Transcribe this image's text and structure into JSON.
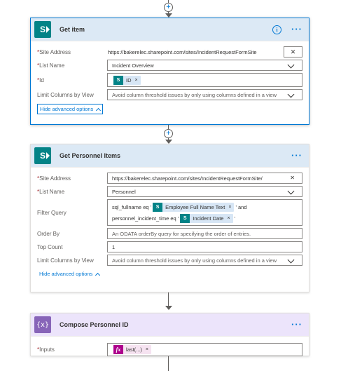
{
  "get_item": {
    "title": "Get item",
    "site_address_label": "Site Address",
    "site_address_value": "https://bakerelec.sharepoint.com/sites/IncidentRequestFormSite",
    "list_name_label": "List Name",
    "list_name_value": "Incident Overview",
    "id_label": "Id",
    "id_token": "ID",
    "limit_label": "Limit Columns by View",
    "limit_placeholder": "Avoid column threshold issues by only using columns defined in a view",
    "advanced_link": "Hide advanced options"
  },
  "get_personnel": {
    "title": "Get Personnel Items",
    "site_address_label": "Site Address",
    "site_address_value": "https://bakerelec.sharepoint.com/sites/IncidentRequestFormSite/",
    "list_name_label": "List Name",
    "list_name_value": "Personnel",
    "filter_label": "Filter Query",
    "filter_line1_prefix": "sql_fullname eq '",
    "filter_token1": "Employee Full Name Text",
    "filter_line1_suffix": "' and",
    "filter_line2_prefix": "personnel_incident_time eq '",
    "filter_token2": "Incident Date",
    "filter_line2_suffix": "'",
    "order_label": "Order By",
    "order_placeholder": "An ODATA orderBy query for specifying the order of entries.",
    "top_label": "Top Count",
    "top_value": "1",
    "limit_label": "Limit Columns by View",
    "limit_placeholder": "Avoid column threshold issues by only using columns defined in a view",
    "advanced_link": "Hide advanced options"
  },
  "compose": {
    "title": "Compose Personnel ID",
    "inputs_label": "Inputs",
    "inputs_token": "last(...)"
  },
  "icons": {
    "required_marker": "*",
    "clear": "✕",
    "token_remove": "×",
    "more": "···",
    "info": "i",
    "plus": "+",
    "fx": "fx",
    "compose_glyph": "{x}",
    "sharepoint_glyph": "S"
  },
  "colors": {
    "accent": "#0078d4",
    "sharepoint": "#038387",
    "compose": "#8764b8",
    "expression": "#ad008c",
    "required": "#a4262c"
  }
}
